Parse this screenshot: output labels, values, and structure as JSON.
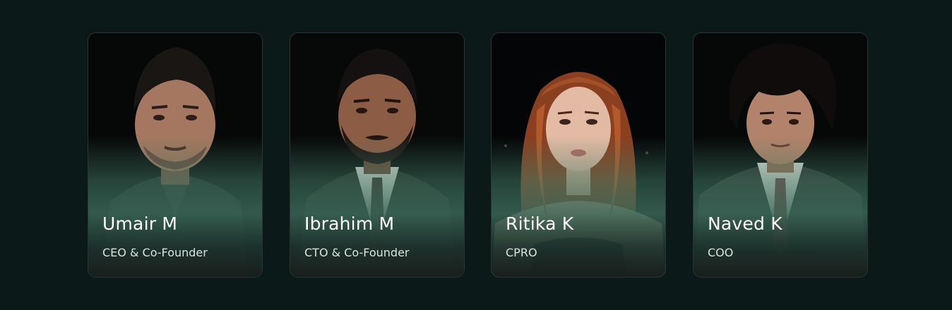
{
  "team": {
    "members": [
      {
        "name": "Umair M",
        "role": "CEO & Co-Founder"
      },
      {
        "name": "Ibrahim M",
        "role": "CTO & Co-Founder"
      },
      {
        "name": "Ritika K",
        "role": "CPRO"
      },
      {
        "name": "Naved K",
        "role": "COO"
      }
    ]
  },
  "colors": {
    "background": "#0b1918",
    "card_border": "#2b3533",
    "gradient_green": "#42786a",
    "name_text": "#ffffff",
    "role_text": "#d9e2df"
  }
}
